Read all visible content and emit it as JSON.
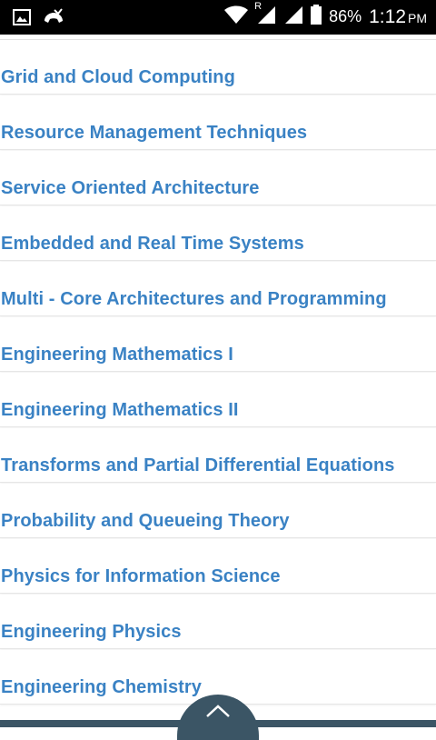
{
  "status_bar": {
    "battery": "86%",
    "time": "1:12",
    "ampm": "PM",
    "network_label": "R",
    "icons": [
      "image-icon",
      "missed-call-icon",
      "wifi-icon",
      "signal-icon",
      "battery-icon"
    ]
  },
  "subjects": [
    "Grid and Cloud Computing",
    "Resource Management Techniques",
    "Service Oriented Architecture",
    "Embedded and Real Time Systems",
    "Multi - Core Architectures and Programming",
    "Engineering Mathematics I",
    "Engineering Mathematics II",
    "Transforms and Partial Differential Equations",
    "Probability and Queueing Theory",
    "Physics for Information Science",
    "Engineering Physics",
    "Engineering Chemistry"
  ],
  "colors": {
    "link": "#3a82c4",
    "bottom_bar": "#3b5565"
  },
  "scroll_top_icon": "chevron-up-icon"
}
